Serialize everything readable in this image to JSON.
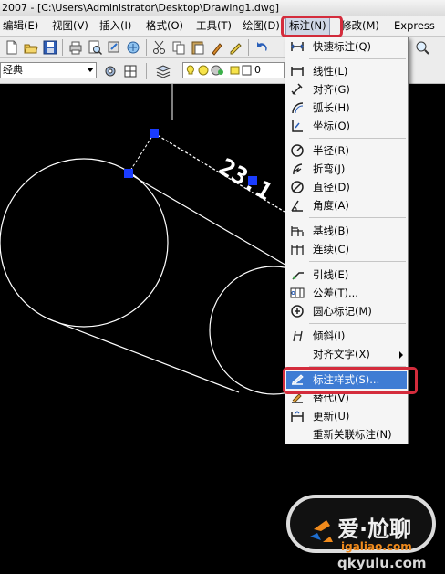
{
  "titlebar": {
    "text": "2007 - [C:\\Users\\Administrator\\Desktop\\Drawing1.dwg]"
  },
  "menubar": {
    "items": [
      {
        "label": "编辑(E)"
      },
      {
        "label": "视图(V)"
      },
      {
        "label": "插入(I)"
      },
      {
        "label": "格式(O)"
      },
      {
        "label": "工具(T)"
      },
      {
        "label": "绘图(D)"
      },
      {
        "label": "标注(N)"
      },
      {
        "label": "修改(M)"
      },
      {
        "label": "Express"
      }
    ]
  },
  "toolbar": {
    "style_combo_value": "经典",
    "layer_value": "0"
  },
  "drawing": {
    "dimension_text": "23.1"
  },
  "dimension_menu": {
    "items": [
      {
        "label": "快速标注(Q)",
        "icon": "quick-dimension-icon"
      },
      {
        "label": "线性(L)",
        "icon": "linear-dimension-icon"
      },
      {
        "label": "对齐(G)",
        "icon": "aligned-dimension-icon"
      },
      {
        "label": "弧长(H)",
        "icon": "arc-length-icon"
      },
      {
        "label": "坐标(O)",
        "icon": "ordinate-icon"
      },
      {
        "label": "半径(R)",
        "icon": "radius-icon"
      },
      {
        "label": "折弯(J)",
        "icon": "jogged-icon"
      },
      {
        "label": "直径(D)",
        "icon": "diameter-icon"
      },
      {
        "label": "角度(A)",
        "icon": "angular-icon"
      },
      {
        "label": "基线(B)",
        "icon": "baseline-icon"
      },
      {
        "label": "连续(C)",
        "icon": "continue-icon"
      },
      {
        "label": "引线(E)",
        "icon": "leader-icon"
      },
      {
        "label": "公差(T)...",
        "icon": "tolerance-icon"
      },
      {
        "label": "圆心标记(M)",
        "icon": "center-mark-icon"
      },
      {
        "label": "倾斜(I)",
        "icon": "oblique-icon"
      },
      {
        "label": "对齐文字(X)",
        "icon": ""
      },
      {
        "label": "标注样式(S)...",
        "icon": "dimension-style-icon"
      },
      {
        "label": "替代(V)",
        "icon": "override-icon"
      },
      {
        "label": "更新(U)",
        "icon": "update-icon"
      },
      {
        "label": "重新关联标注(N)",
        "icon": ""
      }
    ]
  },
  "watermark": {
    "brand_text": "爱·尬聊",
    "url_text": "igaliao.com",
    "sub_text": "qkyulu.com"
  },
  "colors": {
    "menu_highlight": "#3f7cd4",
    "annotation_red": "#d42c3c",
    "grip_blue": "#1a3cff",
    "watermark_orange": "#f08a1c",
    "watermark_blue": "#1f6fd0"
  }
}
